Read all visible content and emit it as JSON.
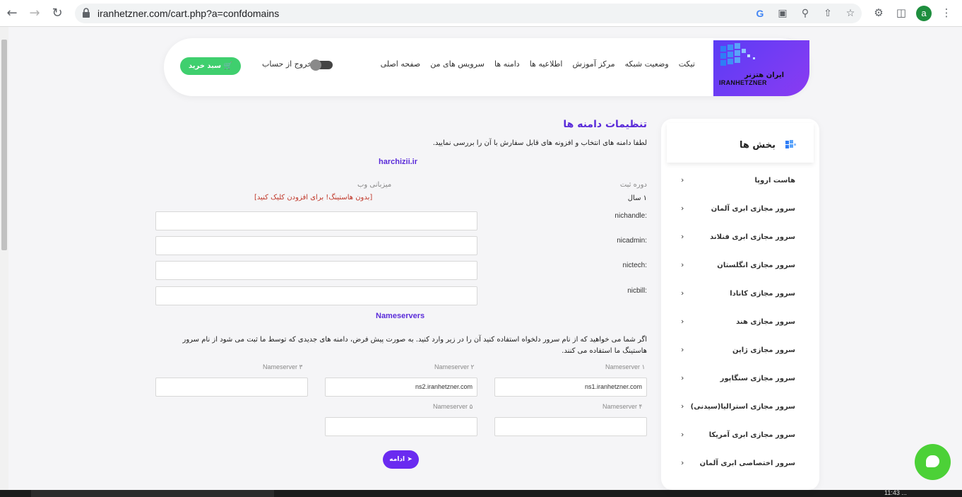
{
  "browser": {
    "url": "iranhetzner.com/cart.php?a=confdomains",
    "avatar_letter": "a"
  },
  "taskbar": {
    "clock": "11:43 ..."
  },
  "header": {
    "logo_fa": "ایران هتزنر",
    "logo_en": "IRANHETZNER",
    "menu": [
      "صفحه اصلی",
      "سرویس های من",
      "دامنه ها",
      "اطلاعیه ها",
      "مرکز آموزش",
      "وضعیت شبکه",
      "تیکت"
    ],
    "logout": "خروج از حساب",
    "cart": "سبد خرید"
  },
  "sidebar": {
    "title": "بخش ها",
    "items": [
      "هاست اروپا",
      "سرور مجازی ابری آلمان",
      "سرور مجازی ابری فنلاند",
      "سرور مجازی انگلستان",
      "سرور مجازی کانادا",
      "سرور مجازی هند",
      "سرور مجازی ژاپن",
      "سرور مجازی سنگاپور",
      "سرور مجازی استرالیا(سیدنی)",
      "سرور مجازی ابری آمریکا",
      "سرور اختصاصی ابری آلمان"
    ]
  },
  "main": {
    "title": "تنظیمات دامنه ها",
    "intro": "لطفا دامنه های انتخاب و افزونه های قابل سفارش با آن را بررسی نمایید.",
    "domain": "harchizii.ir",
    "reg_period_label": "دوره ثبت",
    "reg_period_value": "۱ سال",
    "hosting_label": "میزبانی وب",
    "hosting_value": "[بدون هاستینگ! برای افزودن کلیک کنید]",
    "fields": [
      {
        "label": "nichandle:",
        "value": ""
      },
      {
        "label": "nicadmin:",
        "value": ""
      },
      {
        "label": "nictech:",
        "value": ""
      },
      {
        "label": "nicbill:",
        "value": ""
      }
    ],
    "ns_heading": "Nameservers",
    "ns_desc": "اگر شما می خواهید که از نام سرور دلخواه استفاده کنید آن را در زیر وارد کنید. به صورت پیش فرض، دامنه های جدیدی که توسط ما ثبت می شود از نام سرور هاستینگ ما استفاده می کنند.",
    "nameservers": [
      {
        "label": "Nameserver ۱",
        "value": "ns1.iranhetzner.com"
      },
      {
        "label": "Nameserver ۲",
        "value": "ns2.iranhetzner.com"
      },
      {
        "label": "Nameserver ۳",
        "value": ""
      },
      {
        "label": "Nameserver ۴",
        "value": ""
      },
      {
        "label": "Nameserver ۵",
        "value": ""
      }
    ],
    "continue": "ادامه"
  }
}
